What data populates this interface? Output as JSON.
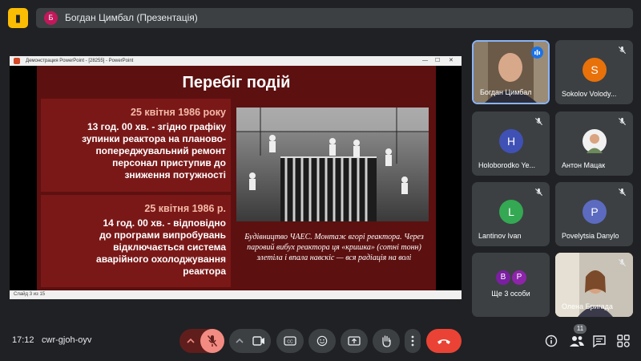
{
  "top_bar": {
    "title_avatar_letter": "Б",
    "title": "Богдан Цимбал (Презентація)"
  },
  "powerpoint": {
    "window_title": "Демонстрация PowerPoint - [28255] - PowerPoint",
    "controls": [
      "—",
      "☐",
      "✕"
    ],
    "status": "Слайд 3 из 15"
  },
  "slide": {
    "title": "Перебіг подій",
    "box1": {
      "date": "25 квітня 1986 року",
      "text": "13 год. 00 хв. - згідно графіку\nзупинки реактора на планово-\nпопереджувальний ремонт\nперсонал приступив до\nзниження потужності"
    },
    "box2": {
      "date": "25 квітня 1986 р.",
      "text": "14 год. 00 хв. - відповідно\nдо програми випробувань\nвідключається система\nаварійного охолоджування\nреактора"
    },
    "caption": "Будівництво ЧАЕС. Монтаж вгорі реактора. Через паровий вибух реактора ця «кришка» (сотні тонн) злетіла і впала навскіс — вся радіація на волі"
  },
  "participants": [
    {
      "name": "Богдан Цимбал",
      "letter": "",
      "color": "",
      "video": true,
      "speaking": true
    },
    {
      "name": "Sokolov Volody...",
      "letter": "S",
      "color": "#e8710a",
      "muted": true
    },
    {
      "name": "Holoborodko Ye...",
      "letter": "H",
      "color": "#3f51b5",
      "muted": true
    },
    {
      "name": "Антон Мацак",
      "letter": "",
      "color": "#e0e0e0",
      "muted": true,
      "photo": true
    },
    {
      "name": "Lantinov Ivan",
      "letter": "L",
      "color": "#34a853",
      "muted": true
    },
    {
      "name": "Povelytsia Danylo",
      "letter": "P",
      "color": "#5c6bc0",
      "muted": true
    },
    {
      "name": "Ще 3 особи",
      "letters": [
        "B",
        "P"
      ],
      "colors": [
        "#7b1fa2",
        "#8e24aa"
      ]
    },
    {
      "name": "Олена Бригада",
      "video": true,
      "muted": true
    }
  ],
  "bottom": {
    "time": "17:12",
    "meeting_code": "cwr-gjoh-oyv",
    "people_count": "11"
  },
  "colors": {
    "background": "#202124",
    "tile": "#3c4043",
    "mic_off": "#f28b82",
    "hangup": "#ea4335",
    "accent": "#8ab4f8"
  }
}
